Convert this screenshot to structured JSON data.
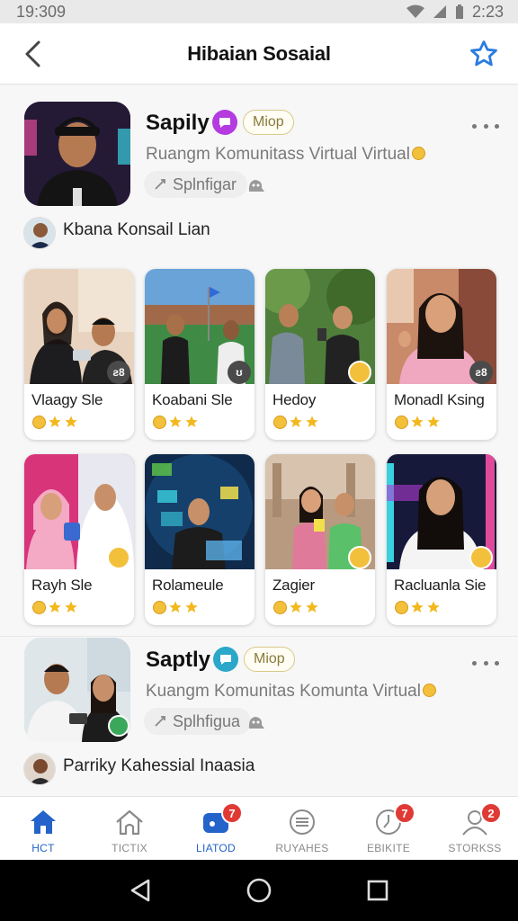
{
  "status_bar": {
    "time": "19:309",
    "right_text": "2:23"
  },
  "header": {
    "title": "Hibaian Sosaial",
    "back_icon": "back-arrow-icon",
    "favorite_icon": "star-icon"
  },
  "groups": [
    {
      "name": "Sapily",
      "pill": "Miop",
      "badge_color": "#b43be0",
      "description": "Ruangm Komunitass Virtual Virtual",
      "tag": "Splnfigar",
      "owner": "Kbana Konsail Lian"
    },
    {
      "name": "Saptly",
      "pill": "Miop",
      "badge_color": "#2aa7c9",
      "description": "Kuangm Komunitas Komunta Virtual",
      "tag": "Splhfigua",
      "owner": "Parriky Kahessial Inaasia"
    }
  ],
  "cards": [
    {
      "name": "Vlaagy Sle",
      "badge": "ƨ8",
      "badge_kind": "dark"
    },
    {
      "name": "Koabani Sle",
      "badge": "ʊ",
      "badge_kind": "dark"
    },
    {
      "name": "Hedoy",
      "badge": "",
      "badge_kind": "gold"
    },
    {
      "name": "Monadl Ksing",
      "badge": "ƨ8",
      "badge_kind": "dark"
    },
    {
      "name": "Rayh Sle",
      "badge": "",
      "badge_kind": "gold"
    },
    {
      "name": "Rolameule",
      "badge": "",
      "badge_kind": "none"
    },
    {
      "name": "Zagier",
      "badge": "",
      "badge_kind": "gold"
    },
    {
      "name": "Racluanla Sie",
      "badge": "",
      "badge_kind": "gold"
    }
  ],
  "bottom_nav": [
    {
      "label": "HCT",
      "icon": "home-icon",
      "active": true,
      "badge": ""
    },
    {
      "label": "TICTIX",
      "icon": "house-outline-icon",
      "active": false,
      "badge": ""
    },
    {
      "label": "LIATOD",
      "icon": "chat-icon",
      "active": false,
      "badge": "7"
    },
    {
      "label": "RUYAHES",
      "icon": "list-icon",
      "active": false,
      "badge": ""
    },
    {
      "label": "EBIKITE",
      "icon": "clock-icon",
      "active": false,
      "badge": "7"
    },
    {
      "label": "STORKSS",
      "icon": "profile-icon",
      "active": false,
      "badge": "2"
    }
  ],
  "colors": {
    "accent": "#2463c9",
    "badge_red": "#e03a35",
    "gold": "#f2c03a"
  }
}
